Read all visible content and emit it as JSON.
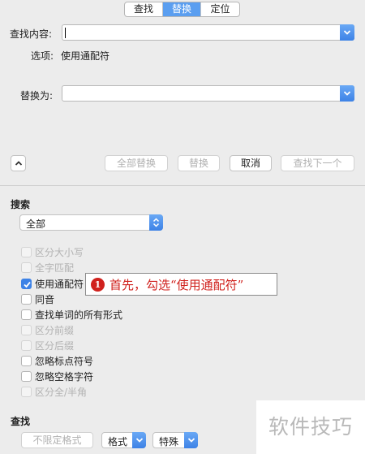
{
  "tabs": [
    "查找",
    "替换",
    "定位"
  ],
  "find": {
    "label": "查找内容:",
    "value": ""
  },
  "options": {
    "label": "选项:",
    "value": "使用通配符"
  },
  "replace": {
    "label": "替换为:",
    "value": ""
  },
  "buttons": {
    "collapse_glyph": "⌃",
    "replace_all": "全部替换",
    "replace": "替换",
    "cancel": "取消",
    "find_next": "查找下一个"
  },
  "search": {
    "heading": "搜索",
    "scope": "全部"
  },
  "checkboxes": [
    {
      "label": "区分大小写",
      "checked": false,
      "enabled": false
    },
    {
      "label": "全字匹配",
      "checked": false,
      "enabled": false
    },
    {
      "label": "使用通配符",
      "checked": true,
      "enabled": true
    },
    {
      "label": "同音",
      "checked": false,
      "enabled": true
    },
    {
      "label": "查找单词的所有形式",
      "checked": false,
      "enabled": true
    },
    {
      "label": "区分前缀",
      "checked": false,
      "enabled": false
    },
    {
      "label": "区分后缀",
      "checked": false,
      "enabled": false
    },
    {
      "label": "忽略标点符号",
      "checked": false,
      "enabled": true
    },
    {
      "label": "忽略空格字符",
      "checked": false,
      "enabled": true
    },
    {
      "label": "区分全/半角",
      "checked": false,
      "enabled": false
    }
  ],
  "callout": {
    "number": "1",
    "text": "首先，勾选“使用通配符”"
  },
  "find_section": {
    "heading": "查找",
    "no_format": "不限定格式",
    "format": "格式",
    "special": "特殊"
  },
  "watermark": "软件技巧",
  "colors": {
    "accent": "#3d82e6",
    "callout_red": "#d0211d"
  }
}
